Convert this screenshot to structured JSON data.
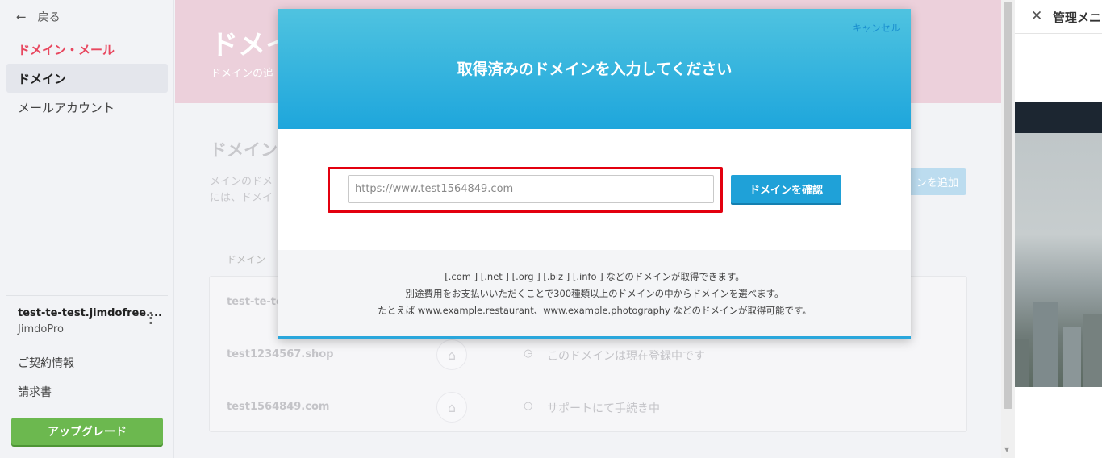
{
  "sidebar": {
    "back_label": "戻る",
    "section_title": "ドメイン・メール",
    "items": [
      {
        "label": "ドメイン"
      },
      {
        "label": "メールアカウント"
      }
    ],
    "site_name": "test-te-test.jimdofree....",
    "site_plan": "JimdoPro",
    "links": [
      {
        "label": "ご契約情報"
      },
      {
        "label": "請求書"
      }
    ],
    "upgrade_label": "アップグレード"
  },
  "main": {
    "hero_title": "ドメイ",
    "hero_sub": "ドメインの追",
    "section_title": "ドメイン",
    "section_desc_1": "メインのドメ",
    "section_desc_2": "には、ドメイ",
    "add_button_label": "ンを追加",
    "column_header": "ドメイン",
    "rows": [
      {
        "domain": "test-te-tes",
        "status": ""
      },
      {
        "domain": "test1234567.shop",
        "status": "このドメインは現在登録中です"
      },
      {
        "domain": "test1564849.com",
        "status": "サポートにて手続き中"
      }
    ]
  },
  "modal": {
    "cancel_label": "キャンセル",
    "title": "取得済みのドメインを入力してください",
    "input_placeholder": "https://www.test1564849.com",
    "confirm_label": "ドメインを確認",
    "footer_lines": [
      "[.com ] [.net ] [.org ] [.biz ] [.info ] などのドメインが取得できます。",
      "別途費用をお支払いいただくことで300種類以上のドメインの中からドメインを選べます。",
      "たとえば www.example.restaurant、www.example.photography などのドメインが取得可能です。"
    ]
  },
  "right_panel": {
    "title": "管理メニ"
  },
  "colors": {
    "accent_pink": "#e8475f",
    "modal_blue": "#1ea6dc",
    "upgrade_green": "#6cb84f",
    "highlight_red": "#e3000f"
  }
}
